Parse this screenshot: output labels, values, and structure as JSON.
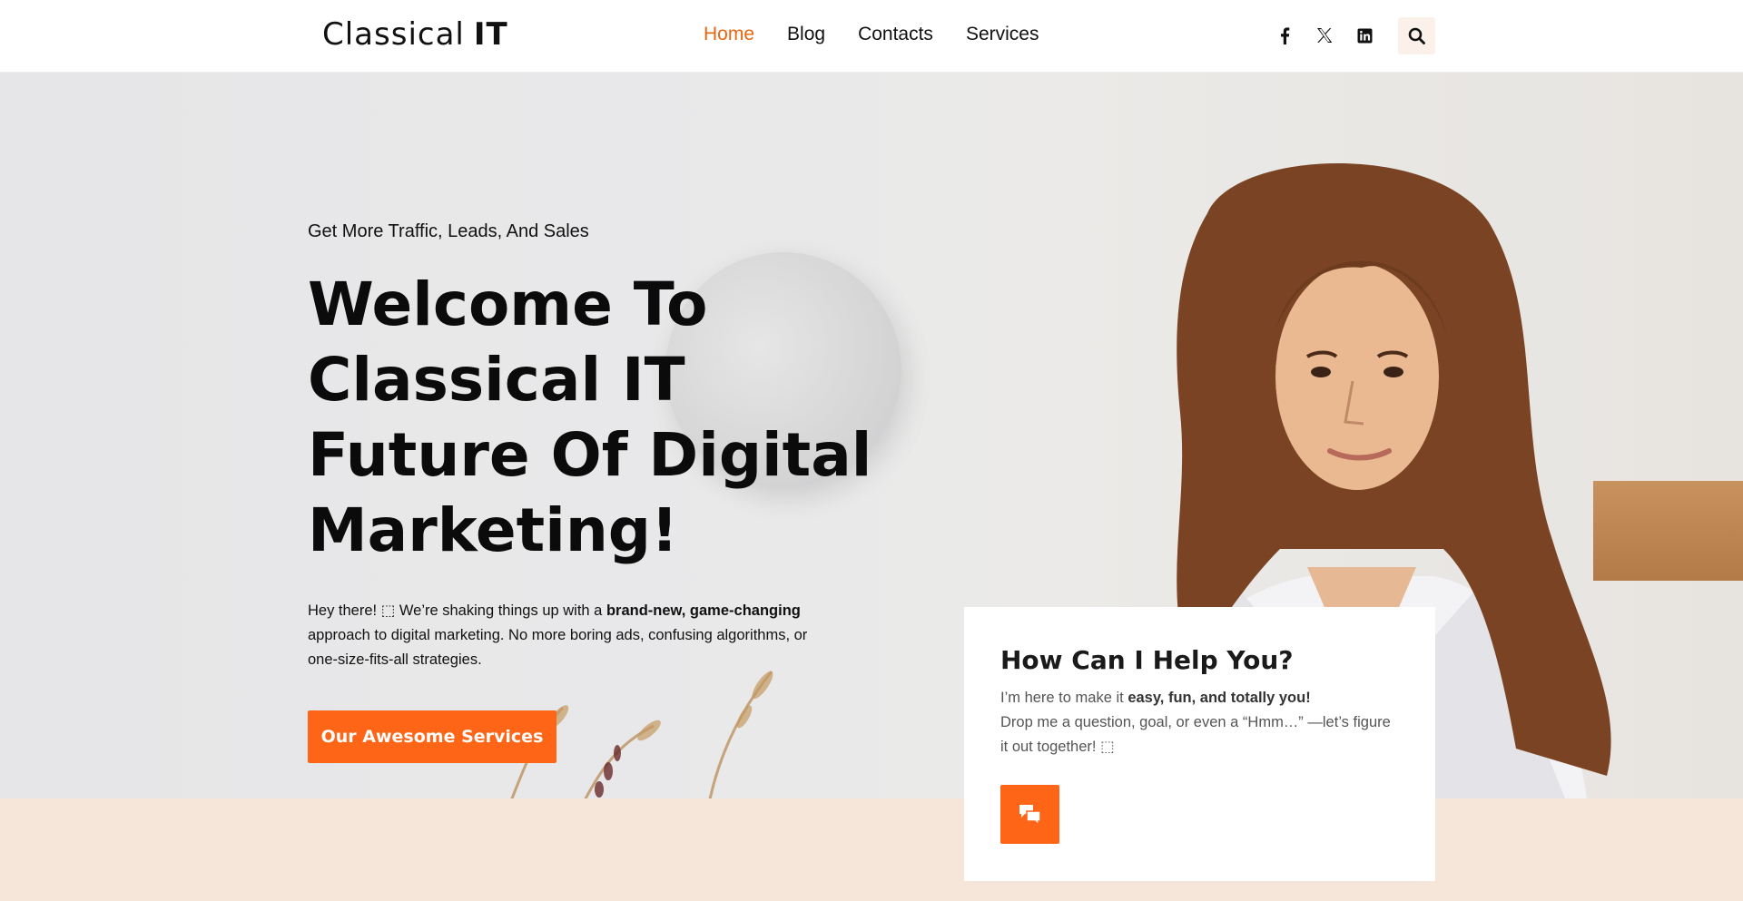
{
  "header": {
    "logo_main": "Classical",
    "logo_tail": "IT",
    "nav": [
      "Home",
      "Blog",
      "Contacts",
      "Services"
    ],
    "socials": [
      "facebook-icon",
      "x-icon",
      "linkedin-icon"
    ],
    "search_icon": "search-icon"
  },
  "hero": {
    "kicker": "Get More Traffic, Leads, And Sales",
    "headline": "Welcome To Classical IT Future Of Digital Marketing!",
    "intro_pre": "Hey there! ⬚ We’re shaking things up with a ",
    "intro_bold": "brand-new, game-changing",
    "intro_post": " approach to digital marketing. No more boring ads, confusing algorithms, or one-size-fits-all strategies.",
    "cta_label": "Our Awesome Services"
  },
  "help_card": {
    "title": "How Can I Help You?",
    "line1_pre": "I’m here to make it ",
    "line1_bold": "easy, fun, and totally you!",
    "line2": "Drop me a question, goal, or even a “Hmm…” —let’s figure it out together! ⬚",
    "button_icon": "chat-icon"
  },
  "colors": {
    "accent": "#ff6516",
    "nav_active": "#e8660f",
    "footer_band": "#f5e6d9"
  }
}
